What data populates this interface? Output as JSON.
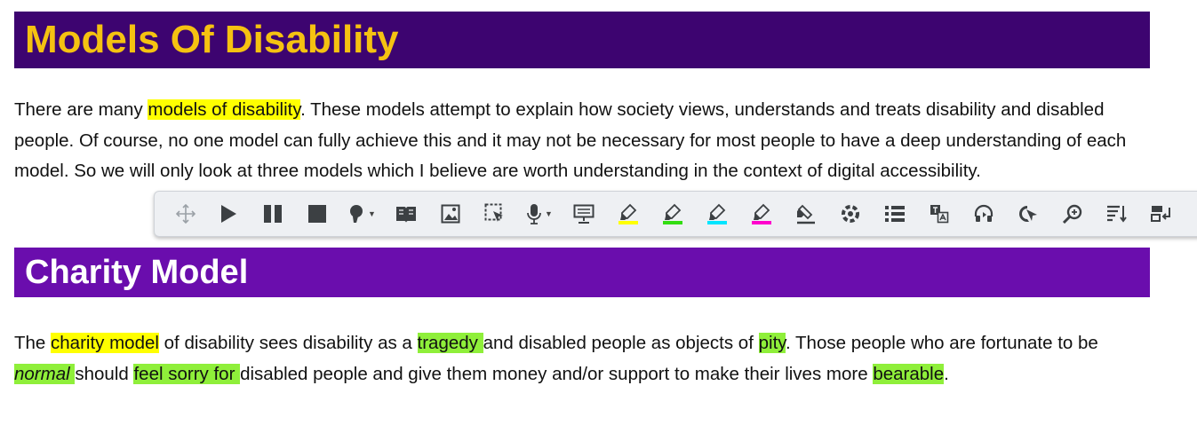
{
  "headings": {
    "models_of_disability": "Models Of Disability",
    "charity_model": "Charity Model"
  },
  "paragraph1": {
    "t1": "There are many ",
    "hl1": "models of disability",
    "t2": ". These models attempt to explain how society views, understands and treats disability and disabled people. Of course, no one model can fully achieve this and it may not be necessary for most people to have a deep understanding of each model. So we will only look at three models which I believe are worth understanding in the context of digital accessibility."
  },
  "paragraph2": {
    "t1": "The ",
    "hl1": "charity model",
    "t2": " of disability sees disability as a ",
    "hl2": "tragedy ",
    "t3": "and disabled people as objects of ",
    "hl3": "pity",
    "t4": ". Those people who are fortunate to be ",
    "hl4": "normal ",
    "t5": "should ",
    "hl5": "feel sorry for ",
    "t6": "disabled people and give them money and/or support to make their lives more ",
    "hl6": "bearable",
    "t7": "."
  },
  "colors": {
    "banner1_bg": "#3d0470",
    "banner1_text": "#f5c211",
    "banner2_bg": "#6a0dad",
    "banner2_text": "#ffffff",
    "highlight_yellow": "#ffff00",
    "highlight_green": "#8fef3a",
    "marker_cyan": "#00e5ff",
    "marker_magenta": "#ff00cc"
  },
  "toolbar": {
    "icons": [
      "move-icon",
      "play-icon",
      "pause-icon",
      "stop-icon",
      "voice-icon",
      "dictionary-icon",
      "picture-dictionary-icon",
      "screen-mask-icon",
      "microphone-icon",
      "web-search-icon",
      "highlight-yellow-icon",
      "highlight-green-icon",
      "highlight-cyan-icon",
      "highlight-magenta-icon",
      "clear-highlights-icon",
      "collect-highlights-icon",
      "vocabulary-list-icon",
      "translate-icon",
      "audio-maker-icon",
      "check-it-icon",
      "rewordify-icon",
      "sort-icon",
      "exit-icon"
    ]
  }
}
